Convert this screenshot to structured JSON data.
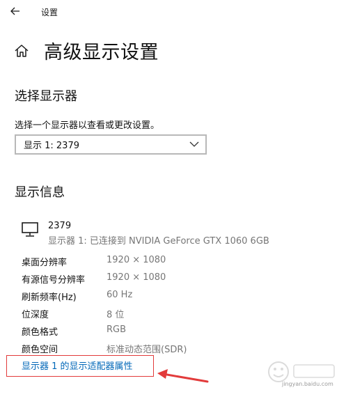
{
  "titlebar": {
    "title": "设置"
  },
  "page": {
    "title": "高级显示设置"
  },
  "select_display": {
    "heading": "选择显示器",
    "instruction": "选择一个显示器以查看或更改设置。",
    "selected": "显示 1: 2379"
  },
  "display_info": {
    "heading": "显示信息",
    "display_name": "2379",
    "connection": "显示器 1: 已连接到 NVIDIA GeForce GTX 1060 6GB",
    "rows": [
      {
        "label": "桌面分辨率",
        "value": "1920 × 1080"
      },
      {
        "label": "有源信号分辨率",
        "value": "1920 × 1080"
      },
      {
        "label": "刷新频率(Hz)",
        "value": "60 Hz"
      },
      {
        "label": "位深度",
        "value": "8 位"
      },
      {
        "label": "颜色格式",
        "value": "RGB"
      },
      {
        "label": "颜色空间",
        "value": "标准动态范围(SDR)"
      }
    ],
    "adapter_link": "显示器 1 的显示适配器属性"
  },
  "watermark": {
    "site": "jingyan.baidu.com"
  },
  "colors": {
    "link": "#0067b8",
    "annotation": "#e23b3b",
    "secondary_text": "#767676"
  },
  "icons": [
    "back-arrow-icon",
    "home-icon",
    "chevron-down-icon",
    "monitor-icon"
  ]
}
